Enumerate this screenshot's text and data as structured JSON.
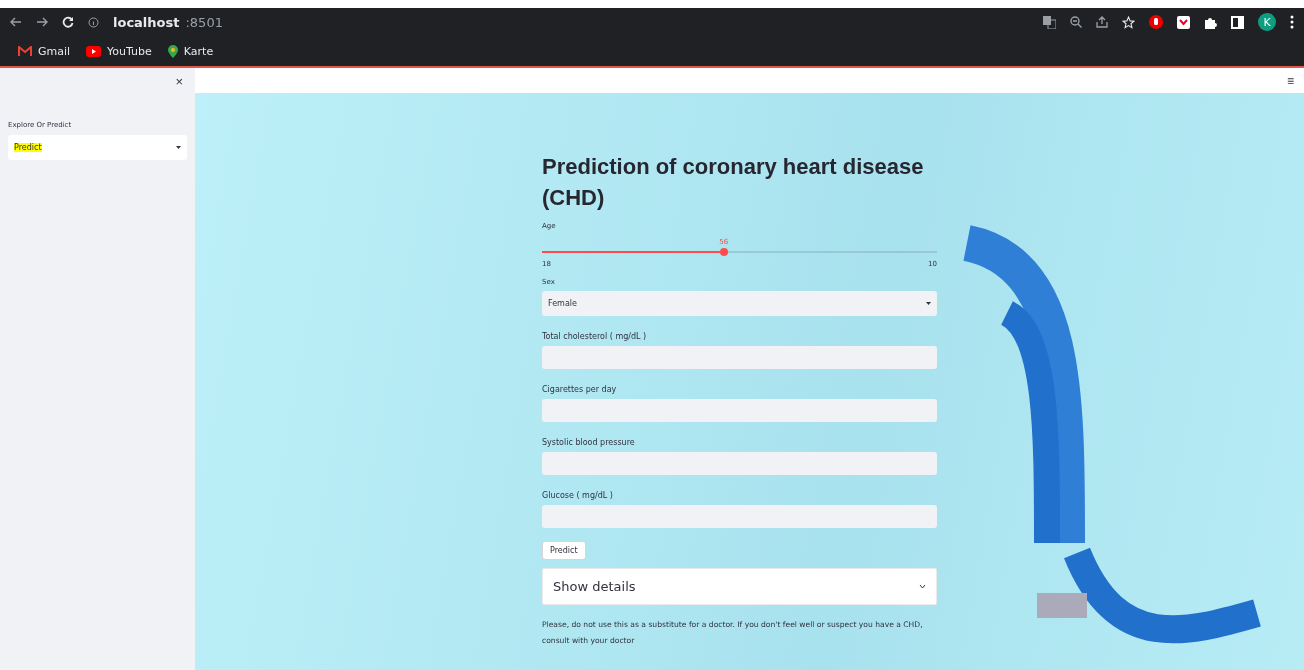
{
  "browser": {
    "url_host": "localhost",
    "url_port": ":8501",
    "bookmarks": [
      {
        "label": "Gmail",
        "kind": "mail"
      },
      {
        "label": "YouTube",
        "kind": "video"
      },
      {
        "label": "Karte",
        "kind": "maps"
      }
    ],
    "profile_initial": "K"
  },
  "sidebar": {
    "close": "×",
    "select_label": "Explore Or Predict",
    "select_value": "Predict",
    "highlighted": true
  },
  "header": {
    "menu": "≡"
  },
  "main": {
    "title": "Prediction of coronary heart disease (CHD)",
    "slider": {
      "label": "Age",
      "value": "56",
      "min": "18",
      "max": "10",
      "level": 0.46
    },
    "sex": {
      "label": "Sex",
      "value": "Female"
    },
    "fields": [
      {
        "label": "Total cholesterol ( mg/dL )"
      },
      {
        "label": "Cigarettes per day"
      },
      {
        "label": "Systolic blood pressure"
      },
      {
        "label": "Glucose ( mg/dL )"
      }
    ],
    "button": "Predict",
    "expander": {
      "label": "Show details",
      "expanded": false
    },
    "note": "Please, do not use this as a substitute for a doctor. If you don't feel well or suspect you have a CHD, consult with your doctor"
  }
}
